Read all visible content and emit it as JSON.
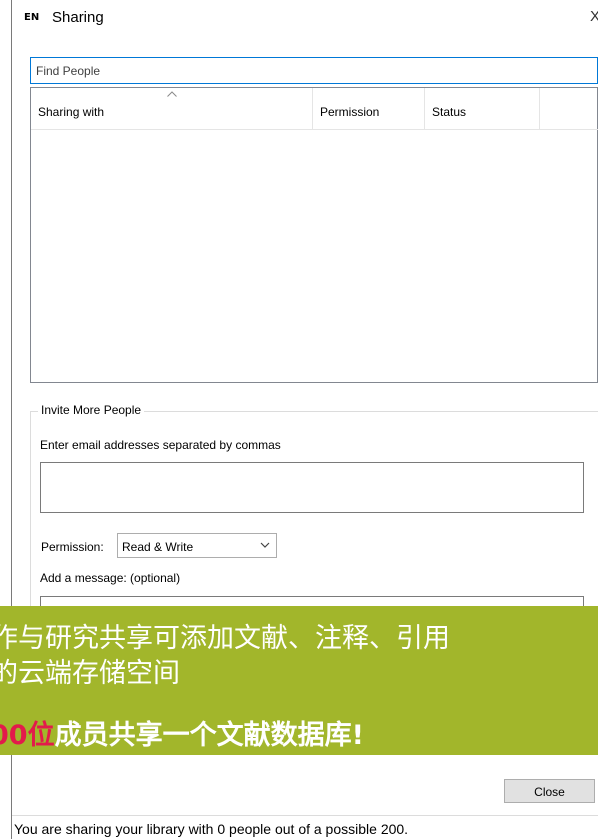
{
  "window": {
    "app_icon": "EN",
    "title": "Sharing",
    "close_glyph": "X"
  },
  "find": {
    "placeholder": "Find People"
  },
  "list": {
    "columns": [
      "Sharing with",
      "Permission",
      "Status"
    ],
    "rows": []
  },
  "invite": {
    "group_title": "Invite More People",
    "email_label": "Enter email addresses separated by commas",
    "email_value": "",
    "permission_label": "Permission:",
    "permission_value": "Read & Write",
    "message_label": "Add a message: (optional)",
    "message_value": ""
  },
  "banner": {
    "line1": "作与研究共享可添加文献、注释、引用",
    "line2": "的云端存储空间",
    "line3_accent": "00位",
    "line3_rest": "成员共享一个文献数据库!",
    "background": "#a2b62b",
    "accent_color": "#e21b4b"
  },
  "buttons": {
    "close": "Close"
  },
  "status": {
    "text": "You are sharing your library with 0 people out of a possible 200."
  }
}
